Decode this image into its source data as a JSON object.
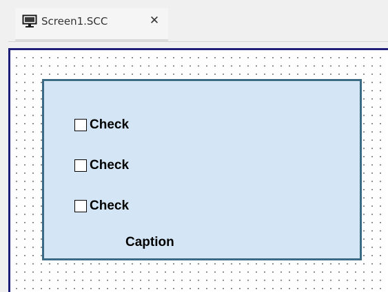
{
  "tab": {
    "title": "Screen1.SCC",
    "icon": "monitor-icon",
    "close_glyph": "✕",
    "close_icon": "close-icon"
  },
  "group": {
    "checkboxes": [
      {
        "label": "Check",
        "checked": false
      },
      {
        "label": "Check",
        "checked": false
      },
      {
        "label": "Check",
        "checked": false
      }
    ],
    "caption": "Caption"
  },
  "colors": {
    "canvas_border": "#1e1e78",
    "panel_fill": "#d4e6f5",
    "panel_border": "#3c6a85"
  }
}
